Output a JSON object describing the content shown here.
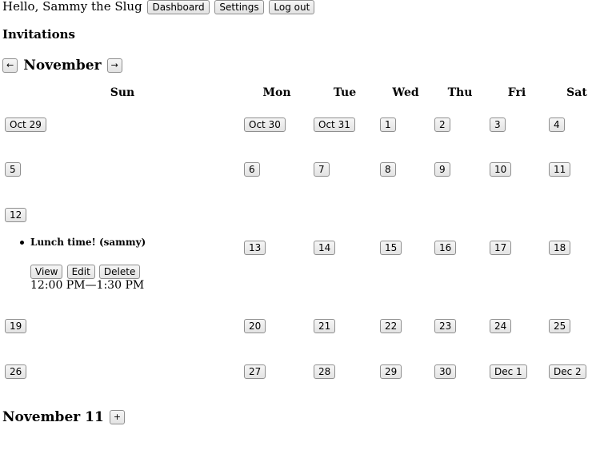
{
  "header": {
    "greeting": "Hello, Sammy the Slug",
    "dashboard_label": "Dashboard",
    "settings_label": "Settings",
    "logout_label": "Log out"
  },
  "invitations": {
    "title": "Invitations"
  },
  "calendar": {
    "prev_label": "←",
    "next_label": "→",
    "month": "November",
    "weekdays": [
      "Sun",
      "Mon",
      "Tue",
      "Wed",
      "Thu",
      "Fri",
      "Sat"
    ],
    "weeks": [
      [
        "Oct 29",
        "Oct 30",
        "Oct 31",
        "1",
        "2",
        "3",
        "4"
      ],
      [
        "5",
        "6",
        "7",
        "8",
        "9",
        "10",
        "11"
      ],
      [
        "12",
        "13",
        "14",
        "15",
        "16",
        "17",
        "18"
      ],
      [
        "19",
        "20",
        "21",
        "22",
        "23",
        "24",
        "25"
      ],
      [
        "26",
        "27",
        "28",
        "29",
        "30",
        "Dec 1",
        "Dec 2"
      ]
    ]
  },
  "event": {
    "title": "Lunch time! (sammy)",
    "view_label": "View",
    "edit_label": "Edit",
    "delete_label": "Delete",
    "time": "12:00 PM—1:30 PM"
  },
  "selected_day": {
    "title": "November 11",
    "add_label": "+"
  }
}
